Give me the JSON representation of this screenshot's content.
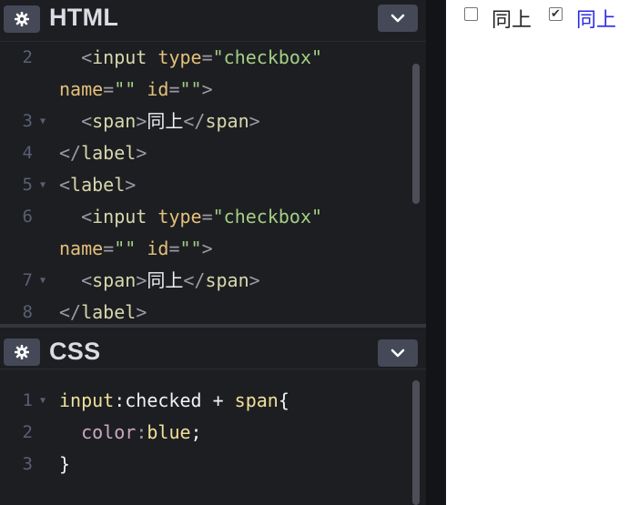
{
  "html_panel": {
    "title": "HTML",
    "icon": "gear-icon",
    "collapse_icon": "chevron-down-icon",
    "lines": [
      {
        "num": "2",
        "fold": "",
        "parts": [
          [
            "  ",
            "plain"
          ],
          [
            "<",
            "br"
          ],
          [
            "input",
            "tag"
          ],
          [
            " ",
            "plain"
          ],
          [
            "type",
            "attr"
          ],
          [
            "=",
            "br"
          ],
          [
            "\"checkbox\"",
            "val"
          ]
        ]
      },
      {
        "num": "",
        "fold": "",
        "parts": [
          [
            "name",
            "attr"
          ],
          [
            "=",
            "br"
          ],
          [
            "\"\"",
            "val"
          ],
          [
            " ",
            "plain"
          ],
          [
            "id",
            "attr"
          ],
          [
            "=",
            "br"
          ],
          [
            "\"\"",
            "val"
          ],
          [
            ">",
            "br"
          ]
        ]
      },
      {
        "num": "3",
        "fold": "▼",
        "parts": [
          [
            "  ",
            "plain"
          ],
          [
            "<",
            "br"
          ],
          [
            "span",
            "tag"
          ],
          [
            ">",
            "br"
          ],
          [
            "同上",
            "txt"
          ],
          [
            "</",
            "br"
          ],
          [
            "span",
            "tag"
          ],
          [
            ">",
            "br"
          ]
        ]
      },
      {
        "num": "4",
        "fold": "",
        "parts": [
          [
            "</",
            "br"
          ],
          [
            "label",
            "tag"
          ],
          [
            ">",
            "br"
          ]
        ]
      },
      {
        "num": "5",
        "fold": "▼",
        "parts": [
          [
            "<",
            "br"
          ],
          [
            "label",
            "tag"
          ],
          [
            ">",
            "br"
          ]
        ]
      },
      {
        "num": "6",
        "fold": "",
        "parts": [
          [
            "  ",
            "plain"
          ],
          [
            "<",
            "br"
          ],
          [
            "input",
            "tag"
          ],
          [
            " ",
            "plain"
          ],
          [
            "type",
            "attr"
          ],
          [
            "=",
            "br"
          ],
          [
            "\"checkbox\"",
            "val"
          ]
        ]
      },
      {
        "num": "",
        "fold": "",
        "parts": [
          [
            "name",
            "attr"
          ],
          [
            "=",
            "br"
          ],
          [
            "\"\"",
            "val"
          ],
          [
            " ",
            "plain"
          ],
          [
            "id",
            "attr"
          ],
          [
            "=",
            "br"
          ],
          [
            "\"\"",
            "val"
          ],
          [
            ">",
            "br"
          ]
        ]
      },
      {
        "num": "7",
        "fold": "▼",
        "parts": [
          [
            "  ",
            "plain"
          ],
          [
            "<",
            "br"
          ],
          [
            "span",
            "tag"
          ],
          [
            ">",
            "br"
          ],
          [
            "同上",
            "txt"
          ],
          [
            "</",
            "br"
          ],
          [
            "span",
            "tag"
          ],
          [
            ">",
            "br"
          ]
        ]
      },
      {
        "num": "8",
        "fold": "",
        "parts": [
          [
            "</",
            "br"
          ],
          [
            "label",
            "tag"
          ],
          [
            ">",
            "br"
          ]
        ]
      }
    ]
  },
  "css_panel": {
    "title": "CSS",
    "icon": "gear-icon",
    "collapse_icon": "chevron-down-icon",
    "lines": [
      {
        "num": "1",
        "fold": "▼",
        "parts": [
          [
            "input",
            "sel"
          ],
          [
            ":checked",
            "plain"
          ],
          [
            " + ",
            "plain"
          ],
          [
            "span",
            "sel"
          ],
          [
            "{",
            "plain"
          ]
        ]
      },
      {
        "num": "2",
        "fold": "",
        "parts": [
          [
            "  ",
            "plain"
          ],
          [
            "color",
            "prop"
          ],
          [
            ":",
            "br"
          ],
          [
            "blue",
            "sel"
          ],
          [
            ";",
            "plain"
          ]
        ]
      },
      {
        "num": "3",
        "fold": "",
        "parts": [
          [
            "}",
            "plain"
          ]
        ]
      }
    ]
  },
  "preview": {
    "items": [
      {
        "label": "同上",
        "checked": false,
        "color": "#222222"
      },
      {
        "label": "同上",
        "checked": true,
        "color": "#2a2ae0"
      }
    ]
  }
}
